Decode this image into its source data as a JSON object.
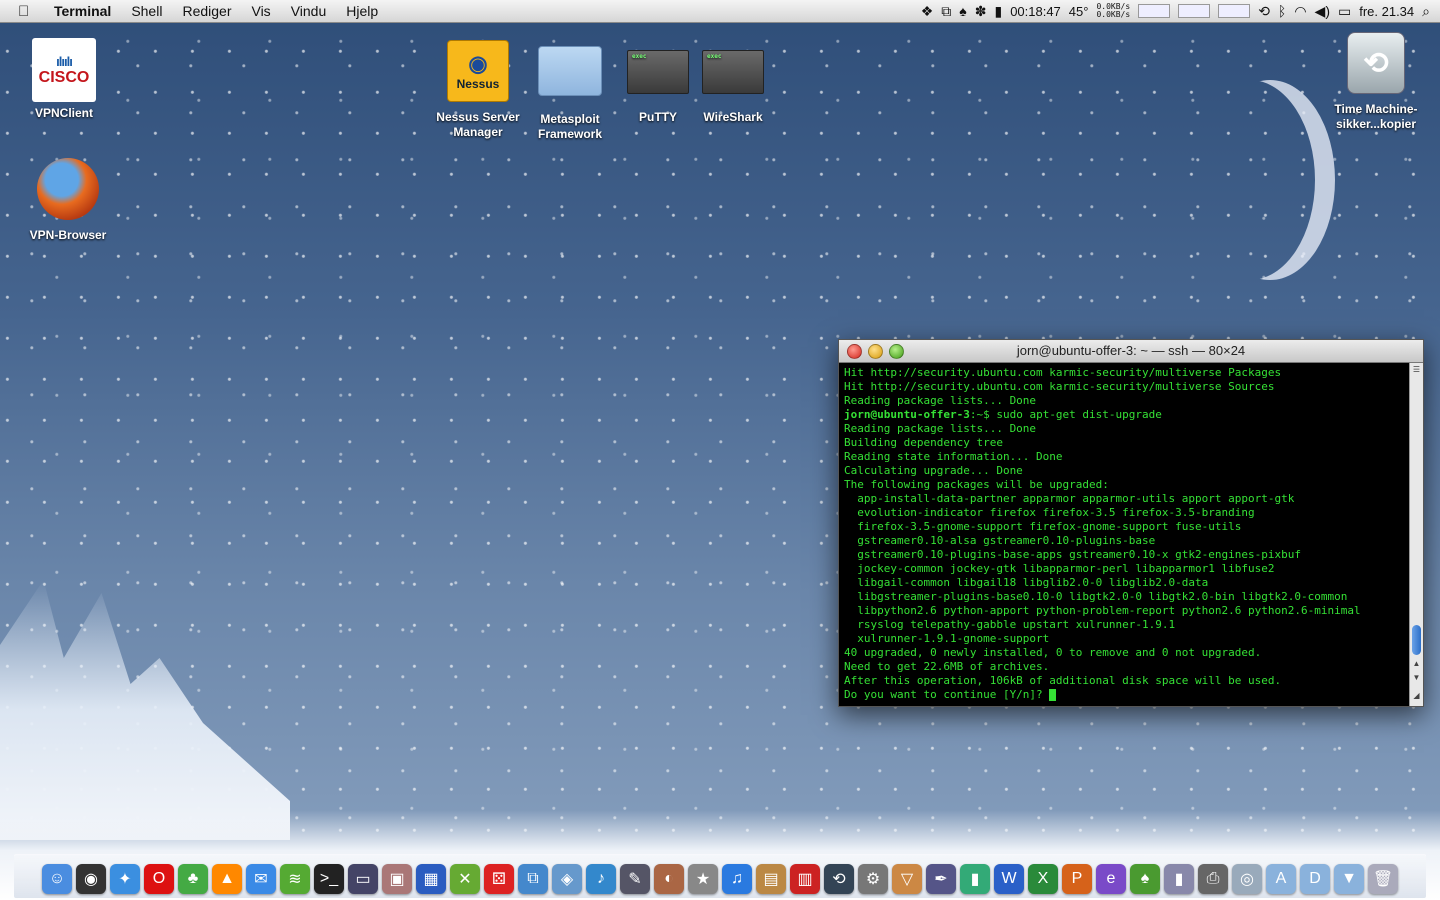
{
  "menubar": {
    "apple_icon": "apple-icon",
    "app_name": "Terminal",
    "items": [
      "Shell",
      "Rediger",
      "Vis",
      "Vindu",
      "Hjelp"
    ],
    "status": {
      "timer": "00:18:47",
      "temp": "45°",
      "net_up": "0.0KB/s",
      "net_down": "0.0KB/s",
      "clock": "fre. 21.34"
    }
  },
  "desktop": {
    "icons": [
      {
        "label": "VPNClient",
        "type": "cisco"
      },
      {
        "label": "VPN-Browser",
        "type": "firefox"
      },
      {
        "label": "Nessus Server Manager",
        "type": "nessus"
      },
      {
        "label": "Metasploit Framework",
        "type": "folder"
      },
      {
        "label": "PuTTY",
        "type": "exec"
      },
      {
        "label": "WireShark",
        "type": "exec"
      },
      {
        "label": "Time Machine-sikker...kopier",
        "type": "timemachine"
      }
    ],
    "cisco_text": "CISCO",
    "cisco_bars": "ılıılı",
    "nessus_text": "Nessus"
  },
  "terminal": {
    "title": "jorn@ubuntu-offer-3: ~ — ssh — 80×24",
    "lines": [
      "Hit http://security.ubuntu.com karmic-security/multiverse Packages",
      "Hit http://security.ubuntu.com karmic-security/multiverse Sources",
      "Reading package lists... Done",
      "",
      "Reading package lists... Done",
      "Building dependency tree",
      "Reading state information... Done",
      "Calculating upgrade... Done",
      "The following packages will be upgraded:",
      "  app-install-data-partner apparmor apparmor-utils apport apport-gtk",
      "  evolution-indicator firefox firefox-3.5 firefox-3.5-branding",
      "  firefox-3.5-gnome-support firefox-gnome-support fuse-utils",
      "  gstreamer0.10-alsa gstreamer0.10-plugins-base",
      "  gstreamer0.10-plugins-base-apps gstreamer0.10-x gtk2-engines-pixbuf",
      "  jockey-common jockey-gtk libapparmor-perl libapparmor1 libfuse2",
      "  libgail-common libgail18 libglib2.0-0 libglib2.0-data",
      "  libgstreamer-plugins-base0.10-0 libgtk2.0-0 libgtk2.0-bin libgtk2.0-common",
      "  libpython2.6 python-apport python-problem-report python2.6 python2.6-minimal",
      "  rsyslog telepathy-gabble upstart xulrunner-1.9.1",
      "  xulrunner-1.9.1-gnome-support",
      "40 upgraded, 0 newly installed, 0 to remove and 0 not upgraded.",
      "Need to get 22.6MB of archives.",
      "After this operation, 106kB of additional disk space will be used.",
      "Do you want to continue [Y/n]? "
    ],
    "prompt_user": "jorn@ubuntu-offer-3",
    "prompt_rest": ":~$ sudo apt-get dist-upgrade"
  },
  "dock": {
    "items": [
      {
        "name": "finder",
        "glyph": "☺",
        "color": "#4a8de0"
      },
      {
        "name": "dashboard",
        "glyph": "◉",
        "color": "#333"
      },
      {
        "name": "safari",
        "glyph": "✦",
        "color": "#3b8fe0"
      },
      {
        "name": "opera",
        "glyph": "O",
        "color": "#d11"
      },
      {
        "name": "adium",
        "glyph": "♣",
        "color": "#4a4"
      },
      {
        "name": "vlc",
        "glyph": "▲",
        "color": "#f80"
      },
      {
        "name": "ichat",
        "glyph": "✉",
        "color": "#3a8ae6"
      },
      {
        "name": "spotify",
        "glyph": "≋",
        "color": "#5a3"
      },
      {
        "name": "terminal",
        "glyph": ">_",
        "color": "#222"
      },
      {
        "name": "display",
        "glyph": "▭",
        "color": "#446"
      },
      {
        "name": "photo",
        "glyph": "▣",
        "color": "#a77"
      },
      {
        "name": "calculator",
        "glyph": "▦",
        "color": "#2a5cc0"
      },
      {
        "name": "keepassx",
        "glyph": "✕",
        "color": "#6a3"
      },
      {
        "name": "dice",
        "glyph": "⚄",
        "color": "#d22"
      },
      {
        "name": "vmware",
        "glyph": "⧉",
        "color": "#48c"
      },
      {
        "name": "cube",
        "glyph": "◈",
        "color": "#69c"
      },
      {
        "name": "office",
        "glyph": "♪",
        "color": "#38c"
      },
      {
        "name": "preview",
        "glyph": "✎",
        "color": "#556"
      },
      {
        "name": "iphoto",
        "glyph": "◐",
        "color": "#a64"
      },
      {
        "name": "star",
        "glyph": "★",
        "color": "#888"
      },
      {
        "name": "itunes",
        "glyph": "♫",
        "color": "#2a7ae0"
      },
      {
        "name": "pages",
        "glyph": "▤",
        "color": "#b84"
      },
      {
        "name": "books",
        "glyph": "▥",
        "color": "#c22"
      },
      {
        "name": "timemachine",
        "glyph": "⟲",
        "color": "#345"
      },
      {
        "name": "sysprefs",
        "glyph": "⚙",
        "color": "#777"
      },
      {
        "name": "keynote",
        "glyph": "▽",
        "color": "#c84"
      },
      {
        "name": "pen",
        "glyph": "✒",
        "color": "#558"
      },
      {
        "name": "numbers",
        "glyph": "▮",
        "color": "#3a7"
      },
      {
        "name": "word",
        "glyph": "W",
        "color": "#2a60c8"
      },
      {
        "name": "excel",
        "glyph": "X",
        "color": "#2a8a3a"
      },
      {
        "name": "powerpoint",
        "glyph": "P",
        "color": "#d6621a"
      },
      {
        "name": "entourage",
        "glyph": "e",
        "color": "#7a4ac8"
      },
      {
        "name": "evernote",
        "glyph": "♠",
        "color": "#4a9a30"
      },
      {
        "name": "bottle",
        "glyph": "▮",
        "color": "#88a"
      },
      {
        "name": "printer",
        "glyph": "⎙",
        "color": "#666"
      },
      {
        "name": "webcam",
        "glyph": "◎",
        "color": "#9ab"
      },
      {
        "name": "applications",
        "glyph": "A",
        "color": "#8ab2dc"
      },
      {
        "name": "documents",
        "glyph": "D",
        "color": "#8ab2dc"
      },
      {
        "name": "downloads",
        "glyph": "▼",
        "color": "#8ab2dc"
      },
      {
        "name": "trash",
        "glyph": "🗑",
        "color": "#aab"
      }
    ]
  }
}
